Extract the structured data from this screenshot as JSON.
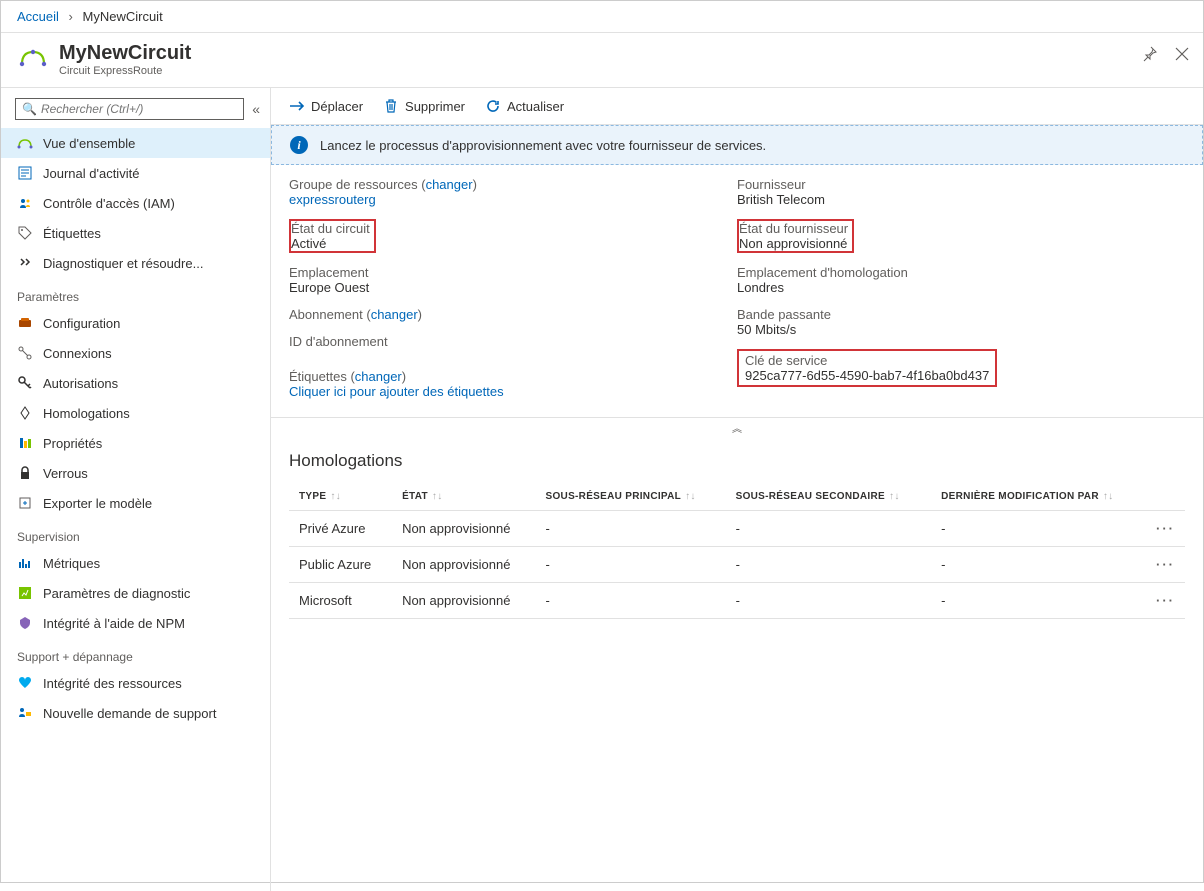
{
  "breadcrumb": {
    "home": "Accueil",
    "current": "MyNewCircuit"
  },
  "header": {
    "title": "MyNewCircuit",
    "subtitle": "Circuit ExpressRoute"
  },
  "search": {
    "placeholder": "Rechercher (Ctrl+/)"
  },
  "sidebar": {
    "items": [
      {
        "label": "Vue d'ensemble"
      },
      {
        "label": "Journal d'activité"
      },
      {
        "label": "Contrôle d'accès (IAM)"
      },
      {
        "label": "Étiquettes"
      },
      {
        "label": "Diagnostiquer et résoudre..."
      }
    ],
    "sections": [
      {
        "title": "Paramètres",
        "items": [
          {
            "label": "Configuration"
          },
          {
            "label": "Connexions"
          },
          {
            "label": "Autorisations"
          },
          {
            "label": "Homologations"
          },
          {
            "label": "Propriétés"
          },
          {
            "label": "Verrous"
          },
          {
            "label": "Exporter le modèle"
          }
        ]
      },
      {
        "title": "Supervision",
        "items": [
          {
            "label": "Métriques"
          },
          {
            "label": "Paramètres de diagnostic"
          },
          {
            "label": "Intégrité à l'aide de NPM"
          }
        ]
      },
      {
        "title": "Support + dépannage",
        "items": [
          {
            "label": "Intégrité des ressources"
          },
          {
            "label": "Nouvelle demande de support"
          }
        ]
      }
    ]
  },
  "toolbar": {
    "move": "Déplacer",
    "delete": "Supprimer",
    "refresh": "Actualiser"
  },
  "banner": {
    "text": "Lancez le processus d'approvisionnement avec votre fournisseur de services."
  },
  "essentials": {
    "left": {
      "rg_label": "Groupe de ressources",
      "rg_change": "changer",
      "rg_value": "expressrouterg",
      "circuit_state_label": "État du circuit",
      "circuit_state_value": "Activé",
      "location_label": "Emplacement",
      "location_value": "Europe Ouest",
      "sub_label": "Abonnement",
      "sub_change": "changer",
      "subid_label": "ID d'abonnement",
      "tags_label": "Étiquettes",
      "tags_change": "changer",
      "tags_add": "Cliquer ici pour ajouter des étiquettes"
    },
    "right": {
      "provider_label": "Fournisseur",
      "provider_value": "British Telecom",
      "provider_state_label": "État du fournisseur",
      "provider_state_value": "Non approvisionné",
      "peering_loc_label": "Emplacement d'homologation",
      "peering_loc_value": "Londres",
      "bandwidth_label": "Bande passante",
      "bandwidth_value": "50 Mbits/s",
      "service_key_label": "Clé de service",
      "service_key_value": "925ca777-6d55-4590-bab7-4f16ba0bd437"
    }
  },
  "homolog": {
    "title": "Homologations",
    "columns": {
      "type": "TYPE",
      "state": "ÉTAT",
      "primary": "SOUS-RÉSEAU PRINCIPAL",
      "secondary": "SOUS-RÉSEAU SECONDAIRE",
      "modified": "DERNIÈRE MODIFICATION PAR"
    },
    "rows": [
      {
        "type": "Privé Azure",
        "state": "Non approvisionné",
        "primary": "-",
        "secondary": "-",
        "modified": "-"
      },
      {
        "type": "Public Azure",
        "state": "Non approvisionné",
        "primary": "-",
        "secondary": "-",
        "modified": "-"
      },
      {
        "type": "Microsoft",
        "state": "Non approvisionné",
        "primary": "-",
        "secondary": "-",
        "modified": "-"
      }
    ]
  }
}
